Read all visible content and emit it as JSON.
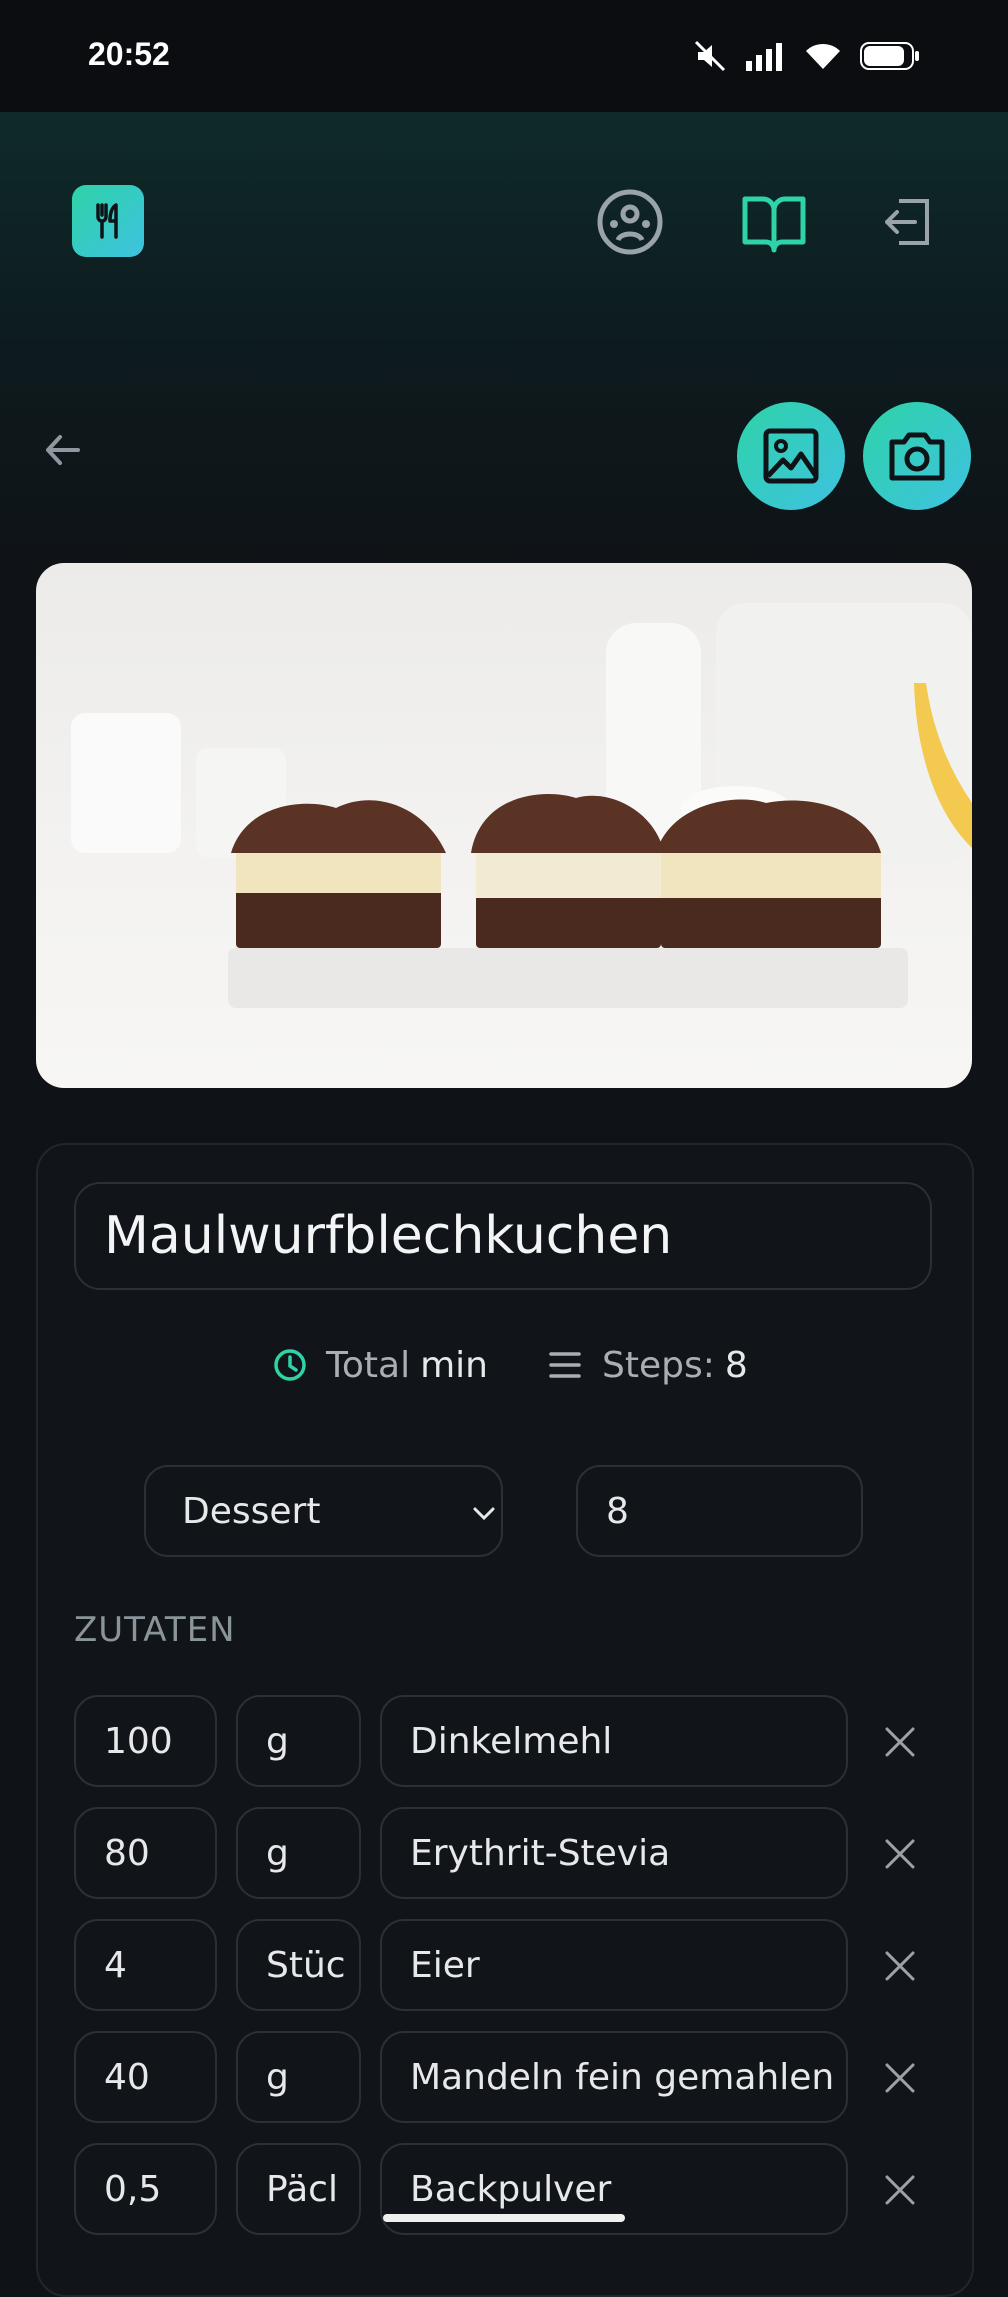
{
  "status": {
    "time": "20:52"
  },
  "nav": {
    "logo": "fork-knife-icon",
    "icons": [
      "community-icon",
      "recipe-book-icon",
      "logout-icon"
    ],
    "active_color": "#2ed3a8"
  },
  "actions": {
    "back": "arrow-left-icon",
    "gallery": "image-icon",
    "camera": "camera-icon"
  },
  "recipe": {
    "title": "Maulwurfblechkuchen",
    "time_label": "Total",
    "time_unit": "min",
    "steps_label": "Steps:",
    "steps_value": "8",
    "category": "Dessert",
    "servings": "8"
  },
  "ingredients_heading": "ZUTATEN",
  "ingredients": [
    {
      "amount": "100",
      "unit": "g",
      "name": "Dinkelmehl"
    },
    {
      "amount": "80",
      "unit": "g",
      "name": "Erythrit-Stevia"
    },
    {
      "amount": "4",
      "unit": "Stüc",
      "name": "Eier"
    },
    {
      "amount": "40",
      "unit": "g",
      "name": "Mandeln fein gemahlen"
    },
    {
      "amount": "0,5",
      "unit": "Päcl",
      "name": "Backpulver"
    }
  ]
}
